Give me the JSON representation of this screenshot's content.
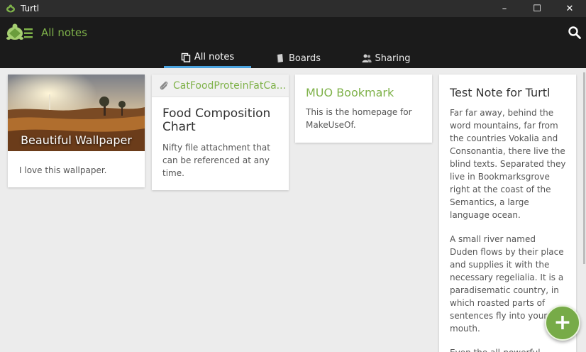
{
  "window": {
    "title": "Turtl",
    "minimize": "–",
    "maximize": "☐",
    "close": "✕"
  },
  "header": {
    "title": "All notes"
  },
  "tabs": [
    {
      "label": "All notes",
      "icon": "notes-icon",
      "active": true
    },
    {
      "label": "Boards",
      "icon": "board-icon",
      "active": false
    },
    {
      "label": "Sharing",
      "icon": "users-icon",
      "active": false
    }
  ],
  "notes": [
    {
      "image_title": "Beautiful Wallpaper",
      "body": "I love this wallpaper."
    },
    {
      "attachment": "CatFoodProteinFatCa...",
      "title": "Food Composition Chart",
      "body": "Nifty file attachment that can be referenced at any time."
    },
    {
      "title": "MUO Bookmark",
      "body": "This is the homepage for MakeUseOf."
    },
    {
      "title": "Test Note for Turtl",
      "paragraphs": [
        "Far far away, behind the word mountains, far from the countries Vokalia and Consonantia, there live the blind texts. Separated they live in Bookmarksgrove right at the coast of the Semantics, a large language ocean.",
        "A small river named Duden flows by their place and supplies it with the necessary regelialia. It is a paradisematic country, in which roasted parts of sentences fly into your mouth.",
        "Even the all-powerful"
      ]
    }
  ],
  "fab": {
    "label": "+"
  },
  "colors": {
    "accent_green": "#7fb24a",
    "tab_indicator": "#4aa3df",
    "header_bg": "#1b1b1b",
    "titlebar_bg": "#2d2d2d",
    "content_bg": "#ececec"
  }
}
